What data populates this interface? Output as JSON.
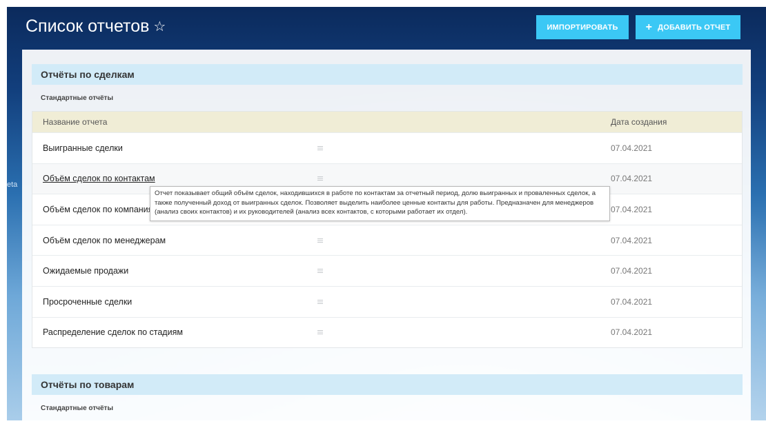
{
  "sidebar": {
    "side_text": "eta"
  },
  "header": {
    "title": "Список отчетов",
    "star_icon": "☆",
    "import_label": "Импортировать",
    "add_icon": "+",
    "add_label": "Добавить отчет"
  },
  "colors": {
    "button": "#3bc8f5",
    "section_header": "#d2ebf8",
    "table_header": "#f0edd6"
  },
  "sections": [
    {
      "title": "Отчёты по сделкам",
      "subtitle": "Стандартные отчёты",
      "columns": {
        "name": "Название отчета",
        "date": "Дата создания"
      },
      "rows": [
        {
          "name": "Выигранные сделки",
          "date": "07.04.2021"
        },
        {
          "name": "Объём сделок по контактам",
          "date": "07.04.2021"
        },
        {
          "name": "Объём сделок по компаниям",
          "date": "07.04.2021"
        },
        {
          "name": "Объём сделок по менеджерам",
          "date": "07.04.2021"
        },
        {
          "name": "Ожидаемые продажи",
          "date": "07.04.2021"
        },
        {
          "name": "Просроченные сделки",
          "date": "07.04.2021"
        },
        {
          "name": "Распределение сделок по стадиям",
          "date": "07.04.2021"
        }
      ]
    },
    {
      "title": "Отчёты по товарам",
      "subtitle": "Стандартные отчёты"
    }
  ],
  "tooltip": {
    "text": "Отчет показывает общий объём сделок, находившихся в работе по контактам за отчетный период, долю выигранных и проваленных сделок, а также полученный доход от выигранных сделок. Позволяет выделить наиболее ценные контакты для работы. Предназначен для менеджеров (анализ своих контактов) и их руководителей (анализ всех контактов, с которыми работает их отдел)."
  }
}
